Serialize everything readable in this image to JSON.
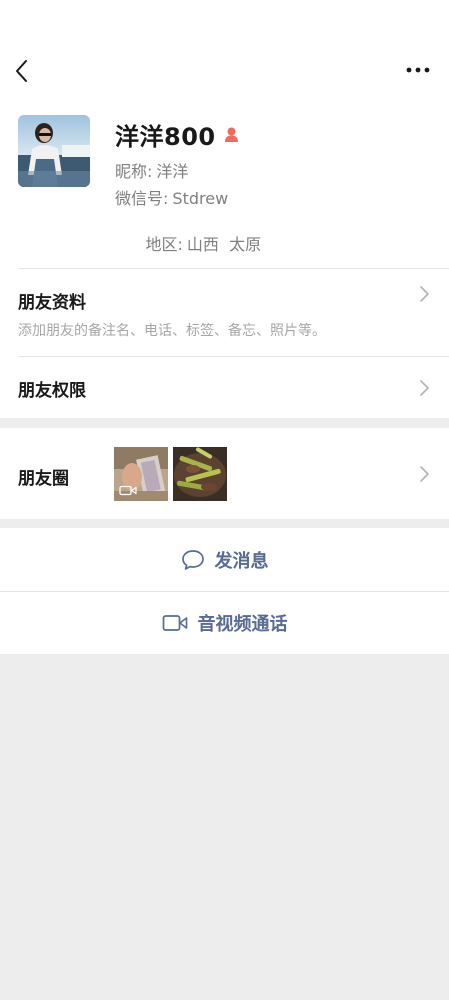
{
  "profile": {
    "name": "洋洋800",
    "nickname_label": "昵称:",
    "nickname": "洋洋",
    "wechat_id_label": "微信号:",
    "wechat_id": "Stdrew",
    "region_label": "地区:",
    "region": "山西  太原"
  },
  "friend_info": {
    "title": "朋友资料",
    "subtitle": "添加朋友的备注名、电话、标签、备忘、照片等。"
  },
  "friend_permissions": {
    "title": "朋友权限"
  },
  "moments": {
    "title": "朋友圈"
  },
  "actions": {
    "message": "发消息",
    "call": "音视频通话"
  },
  "colors": {
    "link_blue": "#576b95",
    "gender_icon": "#f06b5d",
    "background": "#ededed"
  },
  "icons": [
    "back-icon",
    "more-icon",
    "gender-icon",
    "chevron-right-icon",
    "video-icon",
    "chat-bubble-icon",
    "video-call-icon"
  ]
}
